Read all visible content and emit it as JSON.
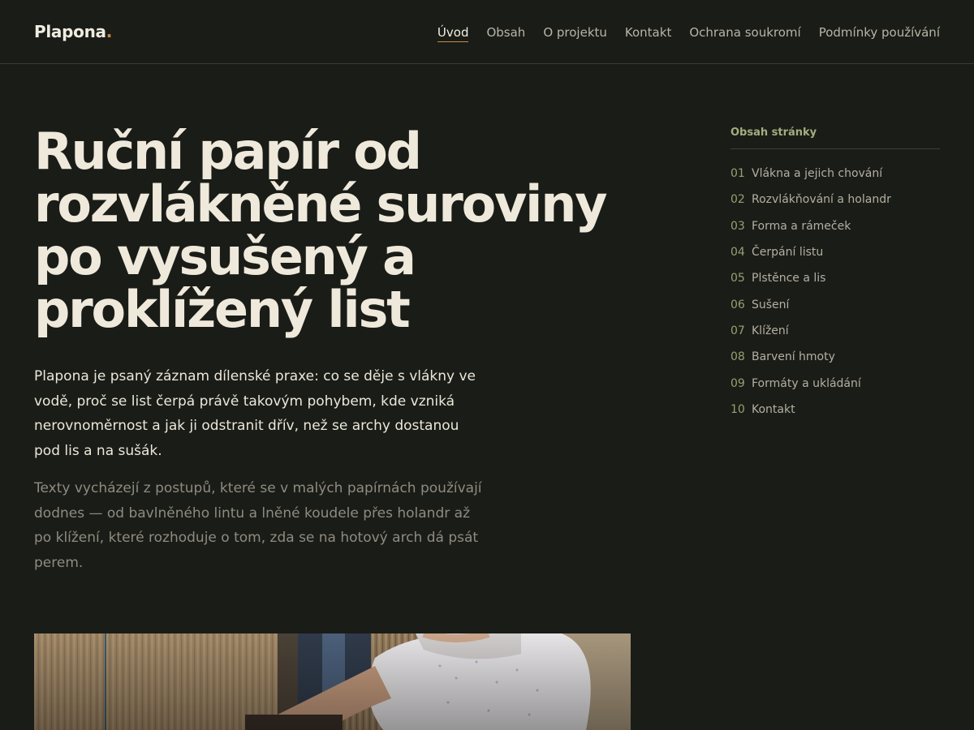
{
  "brand": {
    "name": "Plapona",
    "dot": "."
  },
  "nav": {
    "items": [
      {
        "label": "Úvod",
        "active": true
      },
      {
        "label": "Obsah"
      },
      {
        "label": "O projektu"
      },
      {
        "label": "Kontakt"
      },
      {
        "label": "Ochrana soukromí"
      },
      {
        "label": "Podmínky používání"
      }
    ]
  },
  "hero": {
    "title": "Ruční papír od rozvlákněné suroviny po vysušený a proklížený list",
    "lead": "Plapona je psaný záznam dílenské praxe: co se děje s vlákny ve vodě, proč se list čerpá právě takovým pohybem, kde vzniká nerovnoměrnost a jak ji odstranit dřív, než se archy dostanou pod lis a na sušák.",
    "secondary": "Texty vycházejí z postupů, které se v malých papírnách používají dodnes — od bavlněného lintu a lněné koudele přes holandr až po klížení, které rozhoduje o tom, zda se na hotový arch dá psát perem."
  },
  "toc": {
    "heading": "Obsah stránky",
    "items": [
      {
        "num": "01",
        "label": "Vlákna a jejich chování"
      },
      {
        "num": "02",
        "label": "Rozvlákňování a holandr"
      },
      {
        "num": "03",
        "label": "Forma a rámeček"
      },
      {
        "num": "04",
        "label": "Čerpání listu"
      },
      {
        "num": "05",
        "label": "Plstěnce a lis"
      },
      {
        "num": "06",
        "label": "Sušení"
      },
      {
        "num": "07",
        "label": "Klížení"
      },
      {
        "num": "08",
        "label": "Barvení hmoty"
      },
      {
        "num": "09",
        "label": "Formáty a ukládání"
      },
      {
        "num": "10",
        "label": "Kontakt"
      }
    ]
  },
  "colors": {
    "background": "#1a1c17",
    "accent": "#c98a45",
    "toc_accent": "#a5ad7e"
  }
}
